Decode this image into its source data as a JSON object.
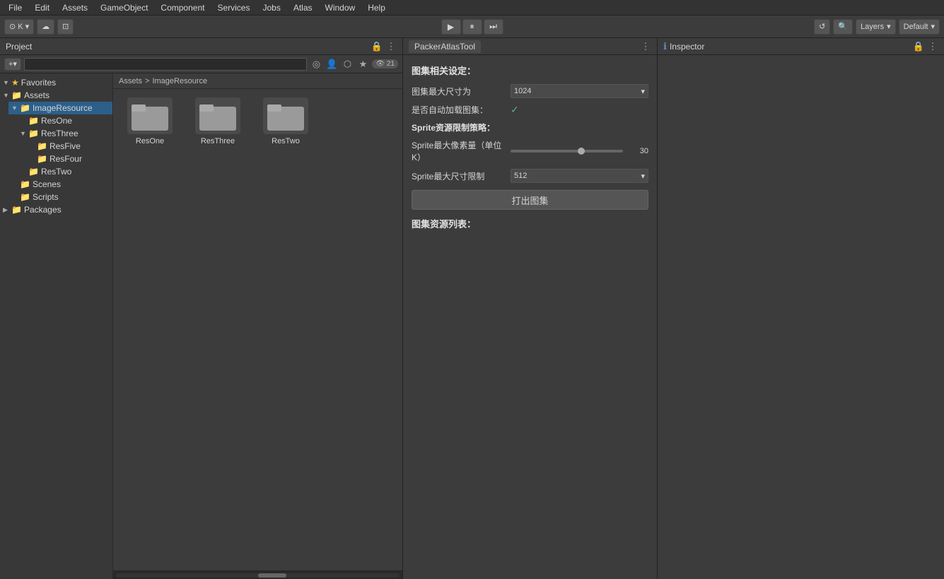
{
  "menubar": {
    "items": [
      "File",
      "Edit",
      "Assets",
      "GameObject",
      "Component",
      "Services",
      "Jobs",
      "Atlas",
      "Window",
      "Help"
    ]
  },
  "toolbar": {
    "account_label": "K",
    "play_btn": "▶",
    "pause_btn": "⏸",
    "step_btn": "⏭",
    "layers_label": "Layers",
    "default_label": "Default",
    "search_icon": "🔍",
    "history_icon": "⟳"
  },
  "project": {
    "tab_label": "Project",
    "add_btn": "+▾",
    "search_placeholder": "",
    "badge": "21",
    "breadcrumb": [
      "Assets",
      ">",
      "ImageResource"
    ]
  },
  "file_tree": {
    "items": [
      {
        "label": "Favorites",
        "indent": 0,
        "arrow": "▼",
        "star": true
      },
      {
        "label": "Assets",
        "indent": 0,
        "arrow": "▼",
        "folder": true
      },
      {
        "label": "ImageResource",
        "indent": 1,
        "arrow": "▼",
        "folder": true,
        "selected": true
      },
      {
        "label": "ResOne",
        "indent": 2,
        "arrow": "",
        "folder": true
      },
      {
        "label": "ResThree",
        "indent": 2,
        "arrow": "▼",
        "folder": true
      },
      {
        "label": "ResFive",
        "indent": 3,
        "arrow": "",
        "folder": true
      },
      {
        "label": "ResFour",
        "indent": 3,
        "arrow": "",
        "folder": true
      },
      {
        "label": "ResTwo",
        "indent": 2,
        "arrow": "",
        "folder": true
      },
      {
        "label": "Scenes",
        "indent": 1,
        "arrow": "",
        "folder": true
      },
      {
        "label": "Scripts",
        "indent": 1,
        "arrow": "",
        "folder": true
      },
      {
        "label": "Packages",
        "indent": 0,
        "arrow": "▶",
        "folder": true
      }
    ]
  },
  "file_browser": {
    "files": [
      {
        "name": "ResOne"
      },
      {
        "name": "ResThree"
      },
      {
        "name": "ResTwo"
      }
    ]
  },
  "packer": {
    "tab_label": "PackerAtlasTool",
    "section1": "图集相关设定：",
    "label_max_size": "图集最大尺寸为",
    "value_max_size": "1024",
    "label_auto_load": "是否自动加载图集：",
    "check_auto_load": "✓",
    "section2_label": "Sprite资源限制策略：",
    "label_max_pixel": "Sprite最大像素量（单位K）",
    "value_max_pixel": "30",
    "label_max_dim": "Sprite最大尺寸限制",
    "value_max_dim": "512",
    "btn_export": "打出图集",
    "section3": "图集资源列表："
  },
  "inspector": {
    "tab_label": "Inspector",
    "icon": "ℹ"
  }
}
